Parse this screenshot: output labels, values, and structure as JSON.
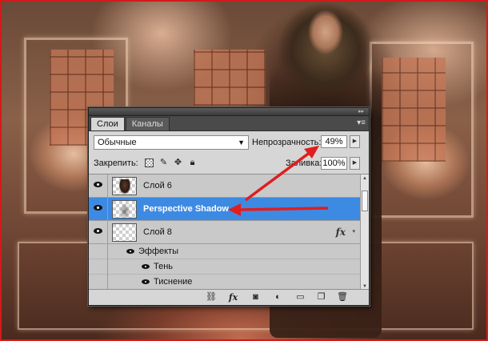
{
  "layers_panel": {
    "tabs": [
      {
        "label": "Слои",
        "active": true
      },
      {
        "label": "Каналы",
        "active": false
      }
    ],
    "blend_mode": "Обычные",
    "opacity_label": "Непрозрачность:",
    "opacity_value": "49%",
    "lock_label": "Закрепить:",
    "fill_label": "Заливка:",
    "fill_value": "100%",
    "layers": [
      {
        "name": "Слой 6",
        "selected": false,
        "visible": true
      },
      {
        "name": "Perspective Shadow",
        "selected": true,
        "visible": true
      },
      {
        "name": "Слой 8",
        "selected": false,
        "visible": true,
        "fx": "fx"
      }
    ],
    "effects": {
      "header": "Эффекты",
      "items": [
        "Тень",
        "Тиснение"
      ]
    },
    "colors": {
      "selection": "#3d8ae3",
      "panel_bg": "#d6d6d6",
      "annotation_arrow": "#e01e1e"
    }
  }
}
